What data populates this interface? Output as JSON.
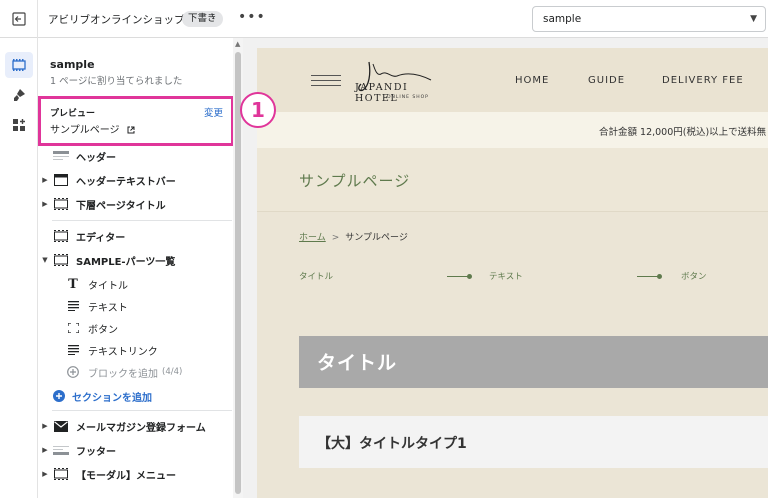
{
  "topbar": {
    "store_name": "アビリブオンラインショップ",
    "status_badge": "下書き",
    "more": "•••",
    "page_select": "sample"
  },
  "sidebar": {
    "template_name": "sample",
    "assigned_text": "1 ページに割り当てられました",
    "preview": {
      "label": "プレビュー",
      "change": "変更",
      "page": "サンプルページ"
    },
    "items": [
      {
        "label": "ヘッダー",
        "icon": "header-icon"
      },
      {
        "label": "ヘッダーテキストバー",
        "icon": "section-icon"
      },
      {
        "label": "下層ページタイトル",
        "icon": "section-icon"
      },
      {
        "label": "エディター",
        "icon": "section-icon"
      },
      {
        "label": "SAMPLE-パーツ一覧",
        "icon": "section-icon"
      },
      {
        "label": "タイトル",
        "icon": "text-t-icon"
      },
      {
        "label": "テキスト",
        "icon": "text-lines-icon"
      },
      {
        "label": "ボタン",
        "icon": "button-frame-icon"
      },
      {
        "label": "テキストリンク",
        "icon": "text-lines-icon"
      },
      {
        "label": "ブロックを追加",
        "count": "(4/4)",
        "icon": "add-circle-icon"
      },
      {
        "label": "セクションを追加",
        "icon": "add-circle-icon"
      },
      {
        "label": "メールマガジン登録フォーム",
        "icon": "mail-icon"
      },
      {
        "label": "フッター",
        "icon": "footer-icon"
      },
      {
        "label": "【モーダル】メニュー",
        "icon": "section-icon"
      }
    ]
  },
  "callout": "1",
  "site": {
    "logo_main": "JAPANDI HOTEL",
    "logo_sub": "ONLINE SHOP",
    "nav": [
      "HOME",
      "GUIDE",
      "DELIVERY FEE"
    ],
    "notice": "合計金額 12,000円(税込)以上で送料無",
    "page_heading": "サンプルページ",
    "breadcrumb": {
      "home": "ホーム",
      "sep": ">",
      "current": "サンプルページ"
    },
    "anchors": [
      "タイトル",
      "テキスト",
      "ボタン"
    ],
    "title_block": "タイトル",
    "type_block": "【大】タイトルタイプ1"
  },
  "colors": {
    "highlight": "#e0359a",
    "link": "#2c6ecb",
    "site_green": "#5f7a4d",
    "site_beige": "#ebe5d6"
  }
}
